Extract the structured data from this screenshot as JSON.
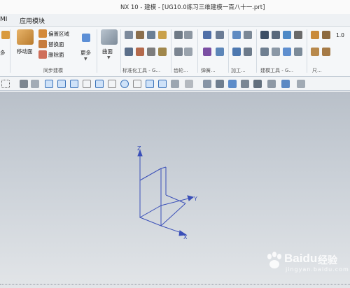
{
  "window": {
    "title": "NX 10 - 建模 - [UG10.0练习三维建模一百八十一.prt]"
  },
  "menu": {
    "left_partial": "MI",
    "app_module": "应用模块"
  },
  "ribbon": {
    "move_face": "移动面",
    "offset_region": "偏置区域",
    "replace_face": "替换面",
    "delete_face": "删除面",
    "more": "更多",
    "surface": "曲面",
    "left_more_partial": "多",
    "groups": {
      "sync_modeling": "同步建模",
      "standard_tools": "标准化工具 - G...",
      "gear": "齿轮...",
      "spring": "弹簧...",
      "machining": "加工...",
      "modeling_tools": "建模工具 - G...",
      "dim_partial": "尺..."
    },
    "counter_partial": "1.0"
  },
  "axes": {
    "z": "Z",
    "y": "Y",
    "x": "X"
  },
  "watermark": {
    "brand": "Baidu",
    "sub": "经验",
    "domain": "jingyan.baidu.com"
  },
  "colors": {
    "axis_blue": "#3a4fb8",
    "viewport_top": "#b9c0c9",
    "viewport_bottom": "#e2e5e8"
  }
}
